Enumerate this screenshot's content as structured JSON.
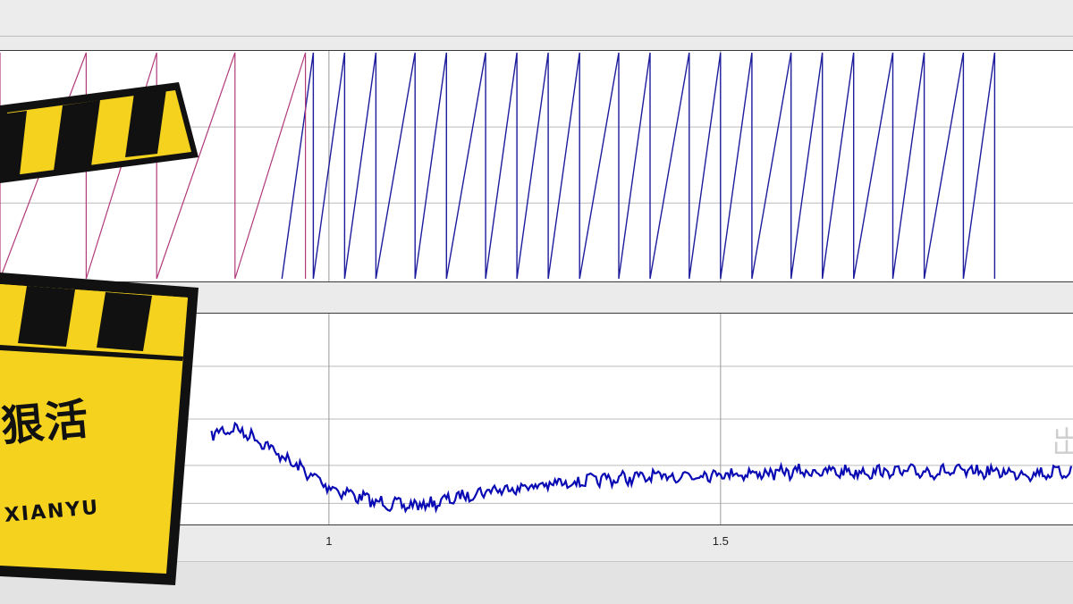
{
  "chart_data": [
    {
      "type": "line",
      "series": [
        {
          "values_description_free": true,
          "x": [
            0.98,
            1.02,
            1.06,
            1.11,
            1.15,
            1.2,
            1.24,
            1.28,
            1.32,
            1.37,
            1.41,
            1.46,
            1.5,
            1.54,
            1.59,
            1.63,
            1.67,
            1.72,
            1.76,
            1.81,
            1.85
          ],
          "color": "#1c1c9c"
        },
        {
          "x": [
            0.58,
            0.69,
            0.78,
            0.88,
            0.97
          ],
          "color": "#b03a7a"
        }
      ],
      "xlim": [
        0.58,
        1.95
      ],
      "grid": true
    },
    {
      "type": "line",
      "series": [
        {
          "x": [
            0.85,
            0.88,
            0.91,
            0.94,
            0.97,
            1.0,
            1.03,
            1.06,
            1.1,
            1.13,
            1.17,
            1.2,
            1.25,
            1.3,
            1.35,
            1.4,
            1.45,
            1.5,
            1.55,
            1.6,
            1.65,
            1.7,
            1.75,
            1.8,
            1.85,
            1.9,
            1.95
          ],
          "y": [
            0.4,
            0.43,
            0.37,
            0.28,
            0.2,
            0.12,
            0.08,
            0.04,
            0.02,
            0.03,
            0.07,
            0.1,
            0.12,
            0.14,
            0.16,
            0.17,
            0.18,
            0.19,
            0.19,
            0.2,
            0.2,
            0.2,
            0.2,
            0.2,
            0.2,
            0.19,
            0.2
          ],
          "color": "#0a0ab4"
        }
      ],
      "xticks": [
        "1",
        "1.5"
      ],
      "xlim": [
        0.58,
        1.95
      ],
      "grid": true
    }
  ],
  "overlay": {
    "badge_text": "狠活",
    "badge_sub": "XIANYU",
    "edge_glyph": "岀"
  }
}
